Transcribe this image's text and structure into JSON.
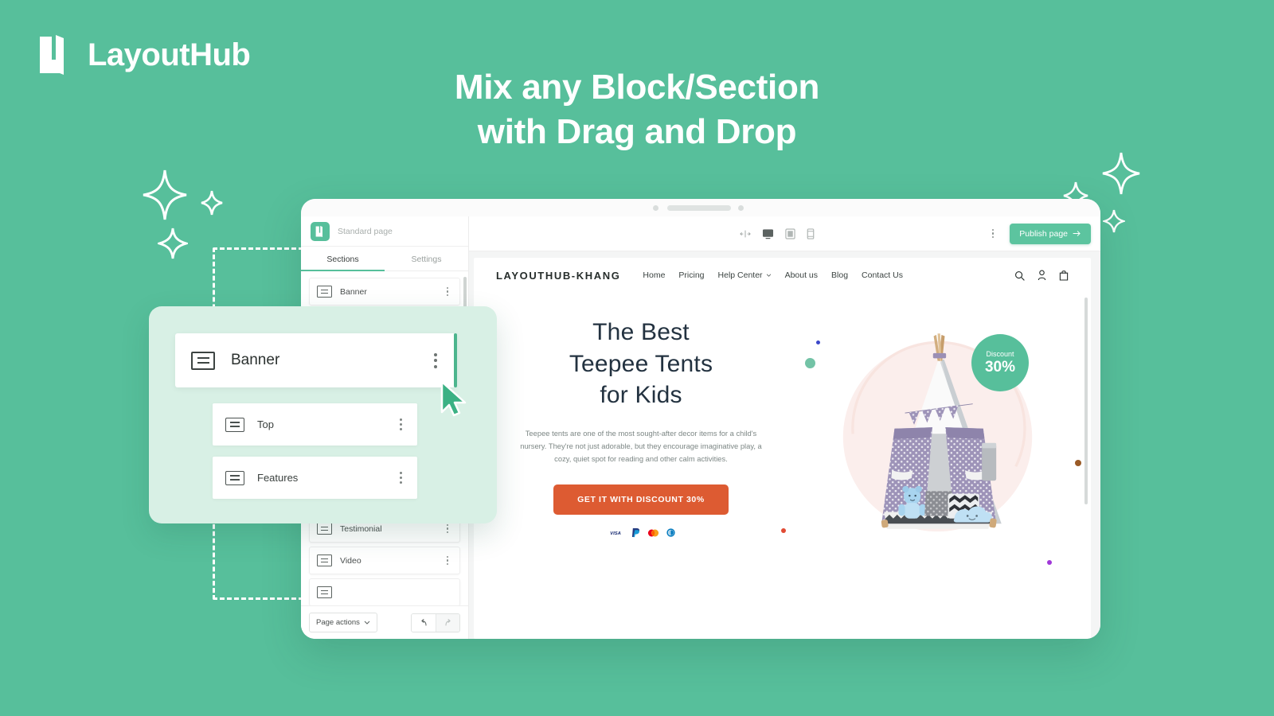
{
  "brand": {
    "name": "LayoutHub",
    "logo_icon": "layouthub-logo-icon",
    "color": "#ffffff"
  },
  "headline": {
    "line1": "Mix any Block/Section",
    "line2": "with Drag and Drop"
  },
  "background": {
    "color": "#57bf9b"
  },
  "editor": {
    "page_name": "Standard page",
    "tabs": [
      {
        "label": "Sections",
        "active": true
      },
      {
        "label": "Settings",
        "active": false
      }
    ],
    "sections": [
      {
        "label": "Banner"
      },
      {
        "label": "Testimonial"
      },
      {
        "label": "Video"
      }
    ],
    "footer": {
      "page_actions_label": "Page actions",
      "undo_icon": "undo-icon",
      "redo_icon": "redo-icon"
    }
  },
  "drag_card": {
    "dragged": {
      "label": "Banner",
      "icon": "block-icon"
    },
    "children": [
      {
        "label": "Top",
        "icon": "block-icon"
      },
      {
        "label": "Features",
        "icon": "block-icon"
      }
    ],
    "cursor_icon": "drag-cursor-icon",
    "card_bg": "#d8f0e5"
  },
  "toolbar": {
    "device_icons": [
      "resize-width-icon",
      "desktop-icon",
      "tablet-icon",
      "mobile-icon"
    ],
    "more_icon": "more-vertical-icon",
    "publish_label": "Publish page",
    "publish_arrow": "arrow-right-icon",
    "publish_color": "#5cc49f"
  },
  "site": {
    "logo": "LAYOUTHUB-KHANG",
    "menu": [
      {
        "label": "Home",
        "has_chevron": false
      },
      {
        "label": "Pricing",
        "has_chevron": false
      },
      {
        "label": "Help Center",
        "has_chevron": true
      },
      {
        "label": "About us",
        "has_chevron": false
      },
      {
        "label": "Blog",
        "has_chevron": false
      },
      {
        "label": "Contact Us",
        "has_chevron": false
      }
    ],
    "icons": [
      "search-icon",
      "account-icon",
      "cart-icon"
    ],
    "hero": {
      "title_line1": "The Best",
      "title_line2": "Teepee Tents",
      "title_line3": "for Kids",
      "description": "Teepee tents are one of the most sought-after decor items for a child's nursery. They're not just adorable, but they encourage imaginative play, a cozy, quiet spot for reading and other calm activities.",
      "cta_label": "GET IT WITH DISCOUNT 30%",
      "cta_color": "#dd5b32",
      "payments": [
        "visa-icon",
        "paypal-icon",
        "mastercard-icon",
        "diners-club-icon"
      ],
      "badge": {
        "label": "Discount",
        "value": "30%",
        "color": "#57bf9b"
      },
      "product_image": "teepee-tent-photo"
    }
  }
}
